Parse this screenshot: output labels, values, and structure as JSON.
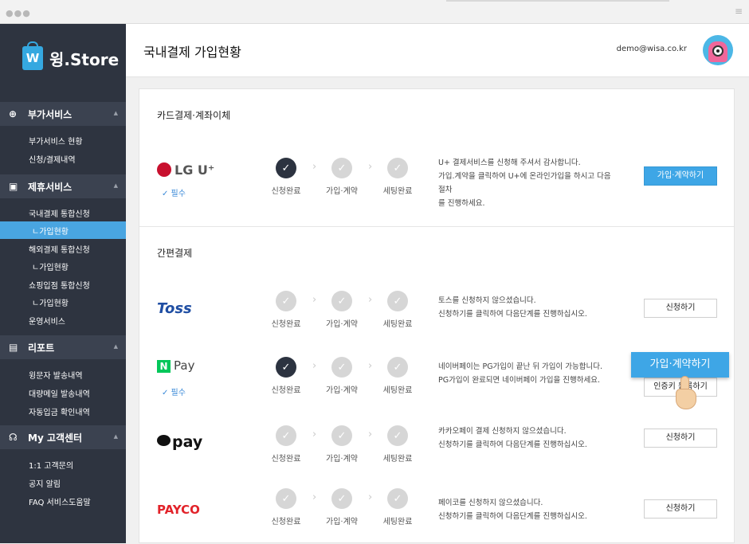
{
  "app": {
    "name": "윙.Store",
    "logo_letter": "W",
    "accent": "#49a5e1"
  },
  "header": {
    "title": "국내결제 가입현황",
    "email": "demo@wisa.co.kr"
  },
  "sidebar": {
    "sections": [
      {
        "label": "부가서비스",
        "icon": "plus-circle-icon",
        "glyph": "⊕",
        "items": [
          {
            "label": "부가서비스 현황"
          },
          {
            "label": "신청/결제내역"
          }
        ]
      },
      {
        "label": "제휴서비스",
        "icon": "calendar-icon",
        "glyph": "▣",
        "items": [
          {
            "label": "국내결제 통합신청"
          },
          {
            "label": "ㄴ가입현황"
          },
          {
            "label": "해외결제 통합신청"
          },
          {
            "label": "ㄴ가입현황"
          },
          {
            "label": "쇼핑입점 통합신청"
          },
          {
            "label": "ㄴ가입현황"
          },
          {
            "label": "운영서비스"
          }
        ]
      },
      {
        "label": "리포트",
        "icon": "report-icon",
        "glyph": "▤",
        "items": [
          {
            "label": "윙문자 발송내역"
          },
          {
            "label": "대량메일 발송내역"
          },
          {
            "label": "자동입금 확인내역"
          }
        ]
      },
      {
        "label": "My 고객센터",
        "icon": "headset-icon",
        "glyph": "☊",
        "items": [
          {
            "label": "1:1 고객문의"
          },
          {
            "label": "공지 알림"
          },
          {
            "label": "FAQ 서비스도움말"
          }
        ]
      }
    ]
  },
  "steps": {
    "s1": "신청완료",
    "s2": "가입·계약",
    "s3": "세팅완료"
  },
  "card_section": {
    "title": "카드결제·계좌이체",
    "provider": {
      "name": "LG U⁺",
      "required": "✓ 필수",
      "desc1": "U+ 결제서비스를 신청해 주셔서 감사합니다.",
      "desc2": "가입.계약을 클릭하여 U+에 온라인가입을 하시고 다음 절차",
      "desc3": "를 진행하세요.",
      "button": "가입·계약하기"
    }
  },
  "easy_section": {
    "title": "간편결제",
    "toss": {
      "name": "Toss",
      "desc1": "토스를 신청하지 않으셨습니다.",
      "desc2": "신청하기를 클릭하여 다음단계를 진행하십시오.",
      "button": "신청하기"
    },
    "npay": {
      "name_n": "N",
      "name": "Pay",
      "required": "✓ 필수",
      "desc1": "네이버페이는 PG가입이 끝난 뒤 가입이 가능합니다.",
      "desc2": "PG가입이 완료되면 네이버페이 가입을 진행하세요.",
      "button": "인증키 등록하기",
      "popup": "가입·계약하기"
    },
    "kakao": {
      "name": "pay",
      "desc1": "카카오페이 결제 신청하지 않으셨습니다.",
      "desc2": "신청하기를 클릭하여 다음단계를 진행하십시오.",
      "button": "신청하기"
    },
    "payco": {
      "name": "PAYCO",
      "desc1": "페이코를 신청하지 않으셨습니다.",
      "desc2": "신청하기를 클릭하여 다음단계를 진행하십시오.",
      "button": "신청하기"
    }
  }
}
